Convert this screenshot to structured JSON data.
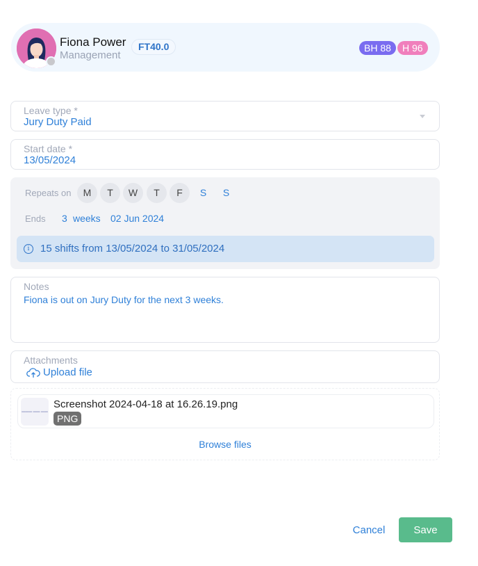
{
  "employee": {
    "name": "Fiona Power",
    "department": "Management",
    "contract_badge": "FT40.0",
    "balances": [
      {
        "label": "BH 88",
        "color": "#7a6cf0"
      },
      {
        "label": "H 96",
        "color": "#f07fbc"
      }
    ],
    "status": "offline"
  },
  "form": {
    "leave_type": {
      "label": "Leave type *",
      "value": "Jury Duty Paid"
    },
    "start_date": {
      "label": "Start date *",
      "value": "13/05/2024"
    },
    "repeat": {
      "label": "Repeats on",
      "days": [
        {
          "label": "M",
          "selected": true
        },
        {
          "label": "T",
          "selected": true
        },
        {
          "label": "W",
          "selected": true
        },
        {
          "label": "T",
          "selected": true
        },
        {
          "label": "F",
          "selected": true
        },
        {
          "label": "S",
          "selected": false
        },
        {
          "label": "S",
          "selected": false
        }
      ],
      "ends_label": "Ends",
      "ends_count": "3",
      "ends_unit": "weeks",
      "ends_date": "02 Jun 2024",
      "summary": "15 shifts from 13/05/2024 to 31/05/2024"
    },
    "notes": {
      "label": "Notes",
      "value": "Fiona is out on Jury Duty for the next 3 weeks."
    },
    "attachments": {
      "label": "Attachments",
      "upload_label": "Upload file",
      "files": [
        {
          "name": "Screenshot 2024-04-18 at 16.26.19.png",
          "type": "PNG"
        }
      ],
      "browse_label": "Browse files"
    }
  },
  "actions": {
    "cancel_label": "Cancel",
    "save_label": "Save"
  },
  "colors": {
    "accent": "#2f80d8",
    "save": "#59bb8c"
  }
}
